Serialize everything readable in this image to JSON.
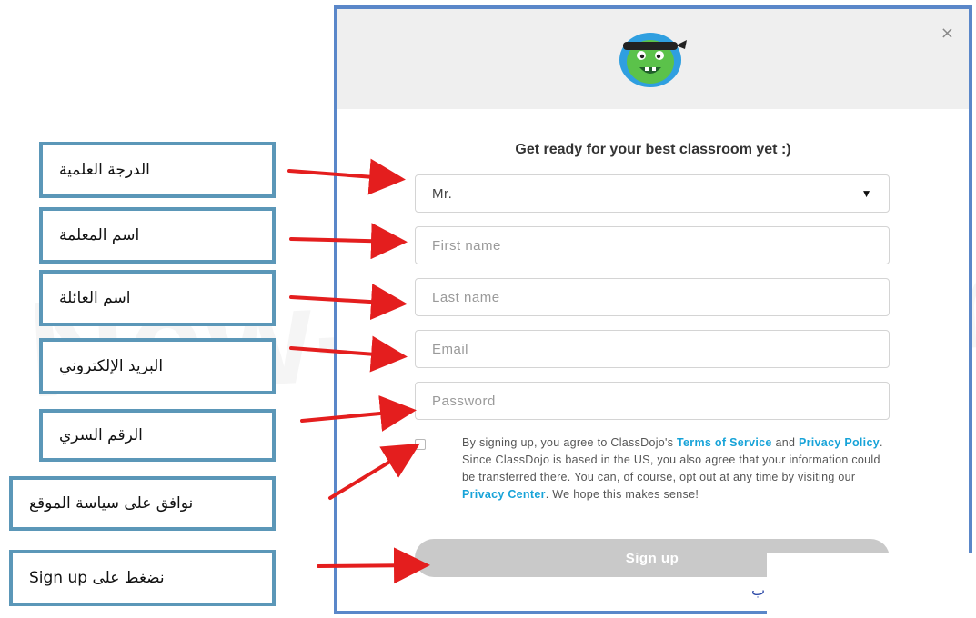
{
  "callouts": [
    {
      "id": "title",
      "text": "الدرجة العلمية"
    },
    {
      "id": "first_name",
      "text": "اسم المعلمة"
    },
    {
      "id": "last_name",
      "text": "اسم العائلة"
    },
    {
      "id": "email",
      "text": "البريد الإلكتروني"
    },
    {
      "id": "password",
      "text": "الرقم السري"
    },
    {
      "id": "policy",
      "text": "نوافق على سياسة الموقع"
    },
    {
      "id": "signup",
      "text": "نضغط على Sign up"
    }
  ],
  "dialog": {
    "close_label": "×",
    "logo_icon": "classdojo-monster-icon",
    "heading": "Get ready for your best classroom yet :)",
    "title_select": {
      "value": "Mr."
    },
    "fields": {
      "first_name_placeholder": "First name",
      "last_name_placeholder": "Last name",
      "email_placeholder": "Email",
      "password_placeholder": "Password"
    },
    "terms": {
      "part1": "By signing up, you agree to ClassDojo's ",
      "terms_link": "Terms of Service",
      "part2": " and ",
      "privacy_link": "Privacy Policy",
      "part3": ". Since ClassDojo is based in the US, you also agree that your information could be transferred there. You can, of course, opt out at any time by visiting our ",
      "privacy_center_link": "Privacy Center",
      "part4": ". We hope this makes sense!"
    },
    "signup_label": "Sign up",
    "bottom_fragment": "ب"
  },
  "watermark": "New-Educ.com",
  "colors": {
    "callout_border": "#5b97b8",
    "dialog_border": "#5a87c9",
    "arrow": "#e41e1e",
    "link": "#17a3d8",
    "signup_bg": "#c9c9c9",
    "header_bg": "#efefef"
  }
}
